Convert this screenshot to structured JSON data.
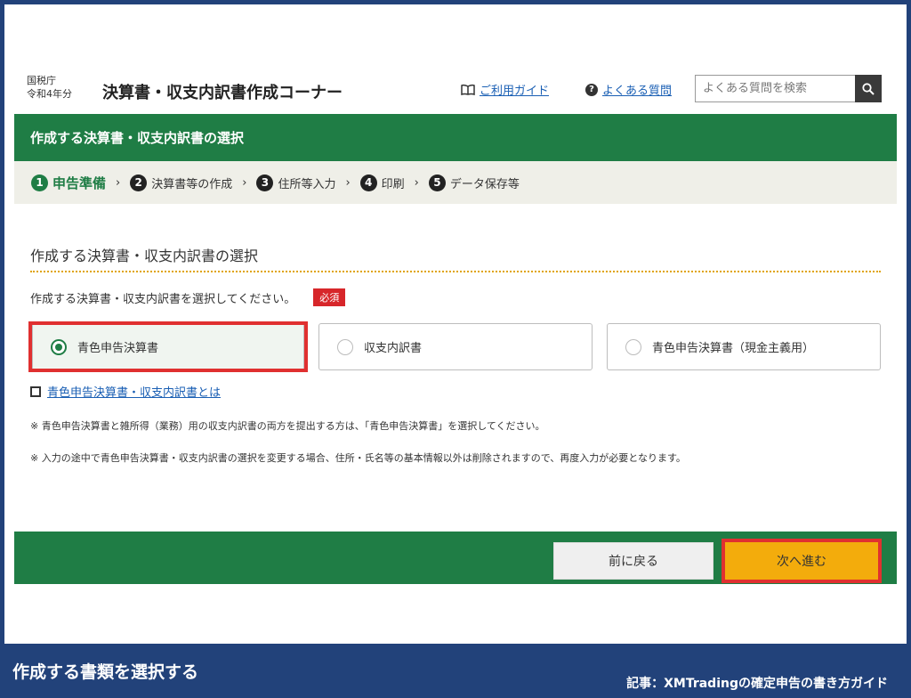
{
  "header": {
    "agency": "国税庁",
    "year": "令和4年分",
    "title": "決算書・収支内訳書作成コーナー",
    "guide_link": "ご利用ガイド",
    "faq_link": "よくある質問",
    "search_placeholder": "よくある質問を検索"
  },
  "page_title": "作成する決算書・収支内訳書の選択",
  "steps": [
    {
      "num": "1",
      "label": "申告準備"
    },
    {
      "num": "2",
      "label": "決算書等の作成"
    },
    {
      "num": "3",
      "label": "住所等入力"
    },
    {
      "num": "4",
      "label": "印刷"
    },
    {
      "num": "5",
      "label": "データ保存等"
    }
  ],
  "steps_chevron": "›",
  "section": {
    "heading": "作成する決算書・収支内訳書の選択",
    "instruction": "作成する決算書・収支内訳書を選択してください。",
    "required_badge": "必須",
    "options": [
      {
        "label": "青色申告決算書",
        "selected": true
      },
      {
        "label": "収支内訳書",
        "selected": false
      },
      {
        "label": "青色申告決算書（現金主義用）",
        "selected": false
      }
    ],
    "info_link": "青色申告決算書・収支内訳書とは",
    "note1": "※ 青色申告決算書と雑所得（業務）用の収支内訳書の両方を提出する方は、「青色申告決算書」を選択してください。",
    "note2": "※ 入力の途中で青色申告決算書・収支内訳書の選択を変更する場合、住所・氏名等の基本情報以外は削除されますので、再度入力が必要となります。"
  },
  "actions": {
    "back_label": "前に戻る",
    "next_label": "次へ進む"
  },
  "caption": {
    "left": "作成する書類を選択する",
    "right": "記事：XMTradingの確定申告の書き方ガイド"
  },
  "colors": {
    "brand_green": "#1f7d45",
    "next_button": "#f3ac0c",
    "highlight_red": "#e03030",
    "frame_navy": "#22427a"
  }
}
